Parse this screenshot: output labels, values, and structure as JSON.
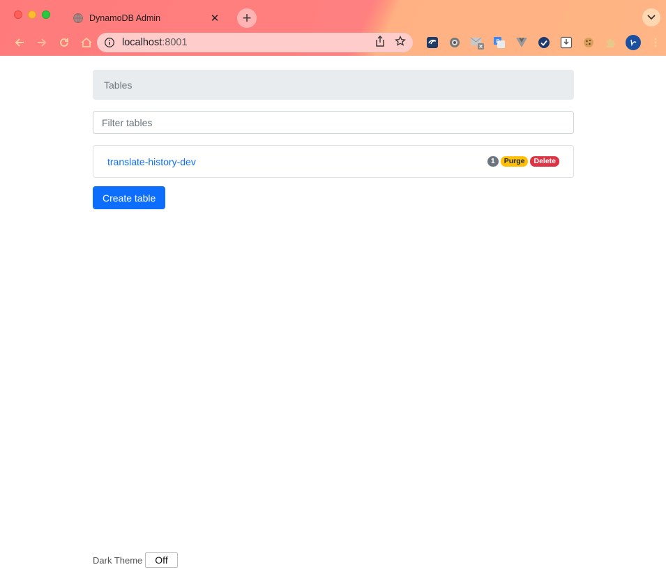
{
  "browser": {
    "tab_title": "DynamoDB Admin",
    "close_glyph": "✕",
    "new_tab_glyph": "+",
    "url_host": "localhost",
    "url_port": ":8001"
  },
  "page": {
    "breadcrumb": "Tables",
    "filter_placeholder": "Filter tables",
    "tables": [
      {
        "name": "translate-history-dev",
        "count": "1",
        "purge_label": "Purge",
        "delete_label": "Delete"
      }
    ],
    "create_table_label": "Create table"
  },
  "footer": {
    "dark_theme_label": "Dark Theme",
    "toggle_value": "Off"
  },
  "colors": {
    "primary": "#0d6efd",
    "warning": "#ffc107",
    "danger": "#dc3545",
    "secondary": "#6c757d"
  }
}
